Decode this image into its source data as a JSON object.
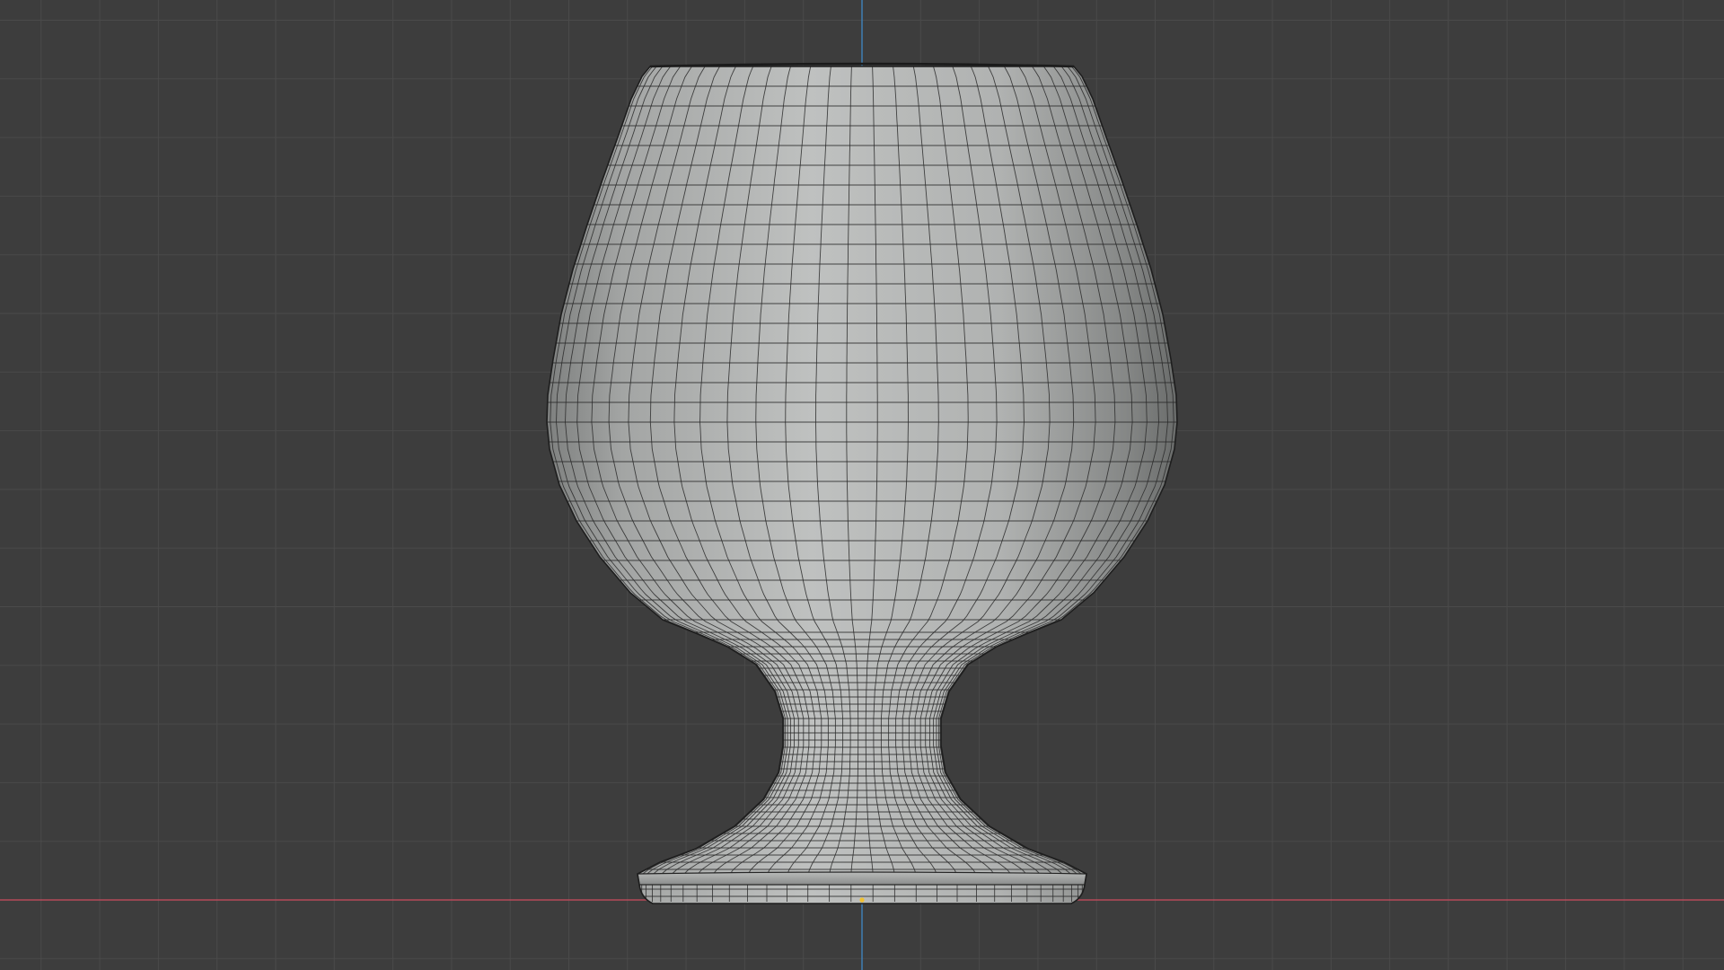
{
  "viewport": {
    "view": "front-orthographic",
    "background_color": "#3d3d3d",
    "grid_color": "#4a4a4a",
    "x_axis_color": "#b54a5a",
    "z_axis_color": "#3f7fb3",
    "origin_color": "#f0c030",
    "grid_visible": true,
    "wireframe_overlay": true
  },
  "object": {
    "type": "mesh",
    "shape": "brandy-snifter",
    "shading": "solid",
    "surface_color": "#b4b6b5",
    "wire_color": "#2a2a2a",
    "selected": false
  }
}
